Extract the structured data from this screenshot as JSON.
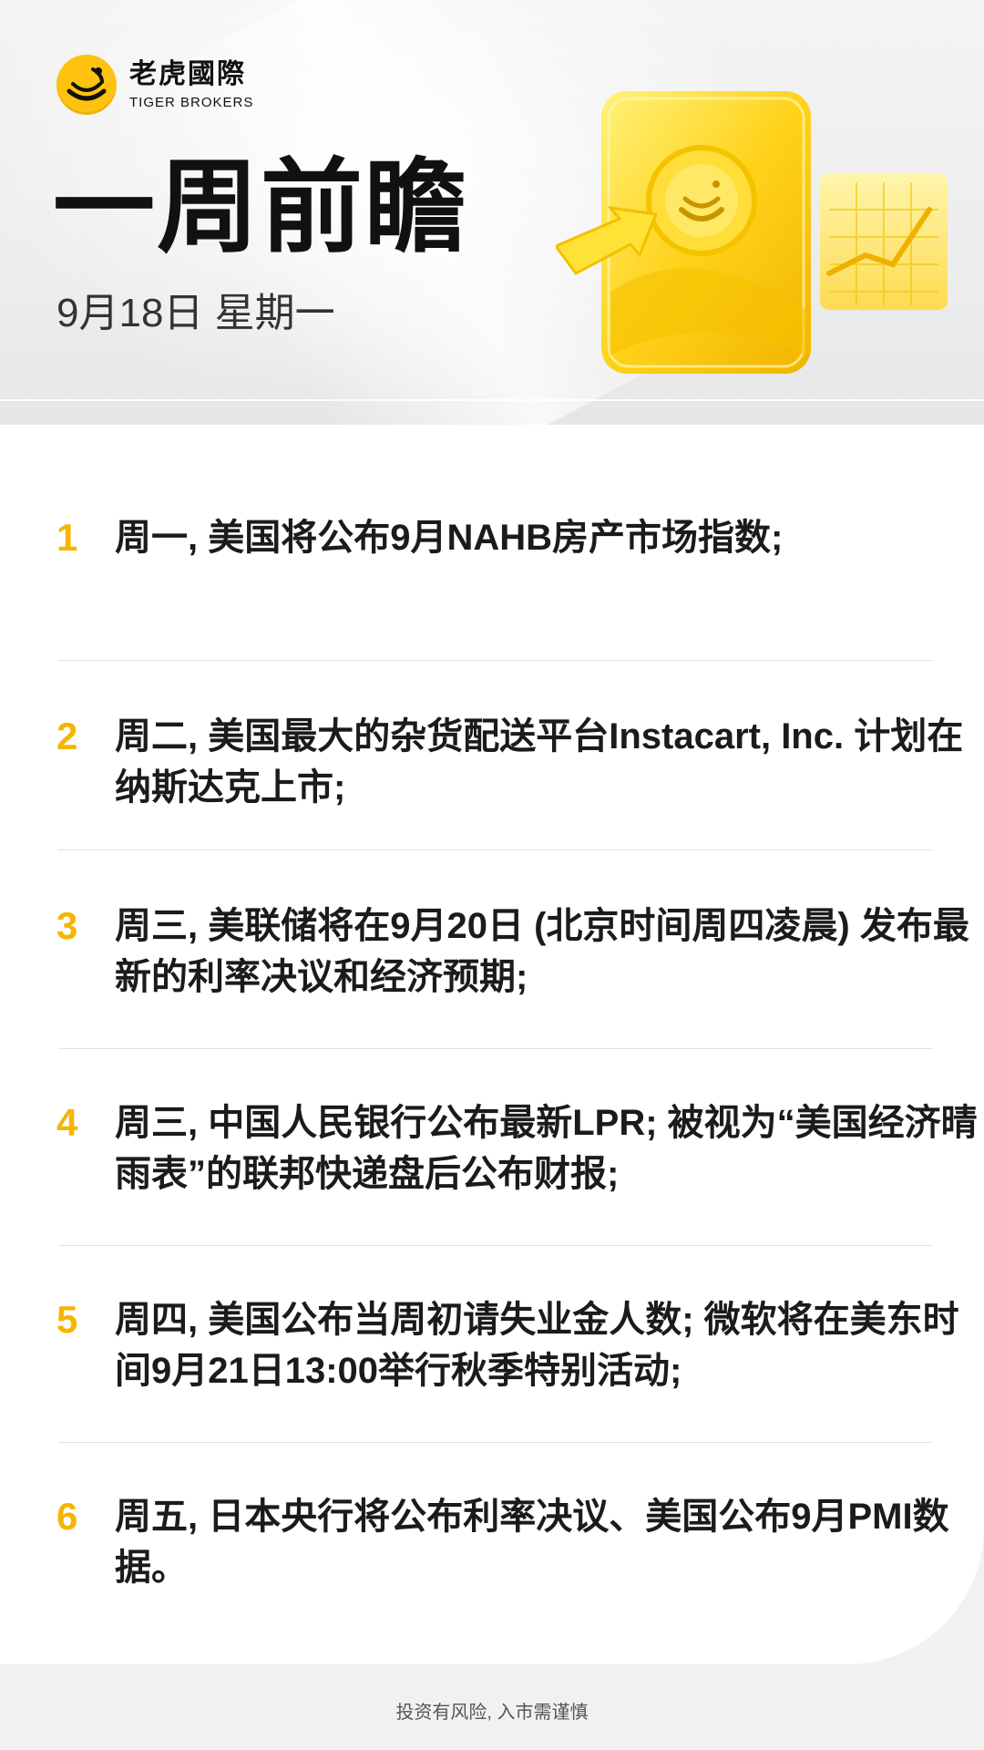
{
  "brand": {
    "name_cn": "老虎國際",
    "name_en": "TIGER BROKERS",
    "logo_icon": "tiger-stripes-icon",
    "accent_color": "#ffc20e"
  },
  "header": {
    "title": "一周前瞻",
    "date": "9月18日 星期一",
    "illustration": "yellow-stock-card-illustration"
  },
  "items": [
    {
      "num": "1",
      "text": "周一, 美国将公布9月NAHB房产市场指数;"
    },
    {
      "num": "2",
      "text": "周二, 美国最大的杂货配送平台Instacart, Inc. 计划在纳斯达克上市;"
    },
    {
      "num": "3",
      "text": "周三, 美联储将在9月20日 (北京时间周四凌晨) 发布最新的利率决议和经济预期;"
    },
    {
      "num": "4",
      "text": "周三, 中国人民银行公布最新LPR; 被视为“美国经济晴雨表”的联邦快递盘后公布财报;"
    },
    {
      "num": "5",
      "text": "周四, 美国公布当周初请失业金人数; 微软将在美东时间9月21日13:00举行秋季特别活动;"
    },
    {
      "num": "6",
      "text": "周五, 日本央行将公布利率决议、美国公布9月PMI数据。"
    }
  ],
  "footer": {
    "disclaimer": "投资有风险, 入市需谨慎"
  }
}
